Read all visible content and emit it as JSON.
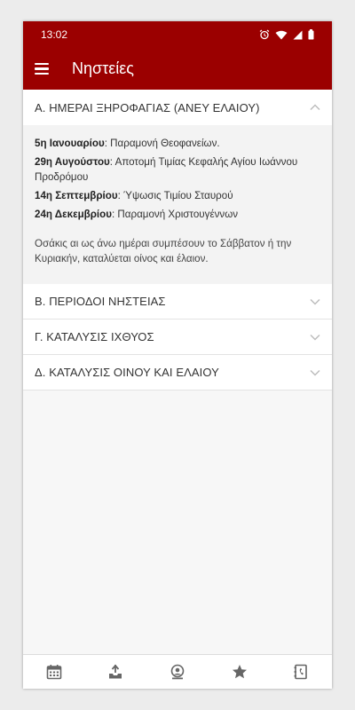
{
  "status": {
    "time": "13:02"
  },
  "appbar": {
    "title": "Νηστείες"
  },
  "sections": [
    {
      "title": "Α. ΗΜΕΡΑΙ ΞΗΡΟΦΑΓΙΑΣ (ΑΝΕΥ ΕΛΑΙΟΥ)",
      "expanded": true
    },
    {
      "title": "Β. ΠΕΡΙΟΔΟΙ ΝΗΣΤΕΙΑΣ",
      "expanded": false
    },
    {
      "title": "Γ. ΚΑΤΑΛΥΣΙΣ ΙΧΘΥΟΣ",
      "expanded": false
    },
    {
      "title": "Δ. ΚΑΤΑΛΥΣΙΣ ΟΙΝΟΥ ΚΑΙ ΕΛΑΙΟΥ",
      "expanded": false
    }
  ],
  "entries": [
    {
      "date": "5η Ιανουαρίου",
      "text": ": Παραμονή Θεοφανείων."
    },
    {
      "date": "29η Αυγούστου",
      "text": ": Αποτομή Τιμίας Κεφαλής Αγίου Ιωάννου Προδρόμου"
    },
    {
      "date": "14η Σεπτεμβρίου",
      "text": ": Ύψωσις Τιμίου Σταυρού"
    },
    {
      "date": "24η Δεκεμβρίου",
      "text": ": Παραμονή Χριστουγέννων"
    }
  ],
  "note": "Οσάκις αι ως άνω ημέραι συμπέσουν το Σάββατον ή την Κυριακήν, καταλύεται οίνος και έλαιον.",
  "colors": {
    "primary": "#9b0000",
    "chevron": "#bbbbbb"
  },
  "nav_icons": [
    "calendar-icon",
    "download-icon",
    "account-icon",
    "star-icon",
    "contacts-icon"
  ]
}
